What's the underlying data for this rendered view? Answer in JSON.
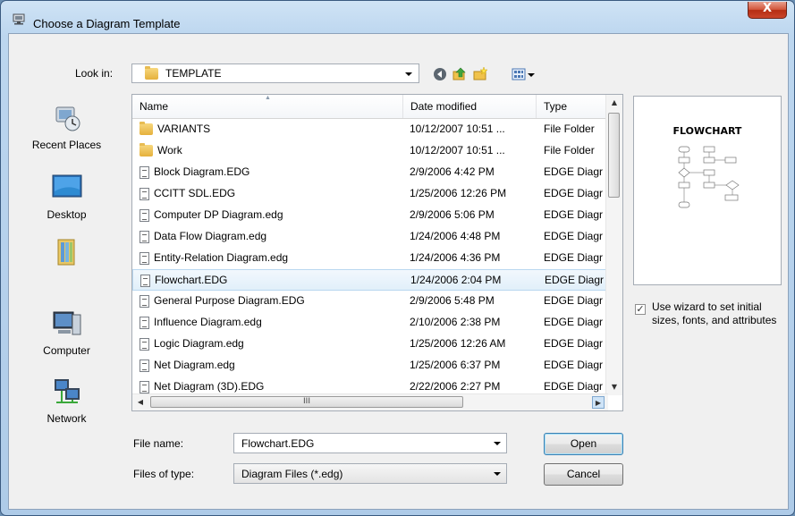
{
  "window": {
    "title": "Choose a Diagram Template",
    "close_label": "X"
  },
  "lookin": {
    "label": "Look in:",
    "value": "TEMPLATE"
  },
  "toolbar_icons": [
    "back-icon",
    "up-folder-icon",
    "new-folder-icon",
    "view-menu-icon"
  ],
  "places": [
    {
      "label": "Recent Places",
      "icon": "recent-places-icon"
    },
    {
      "label": "Desktop",
      "icon": "desktop-icon"
    },
    {
      "label": "",
      "icon": "documents-icon"
    },
    {
      "label": "Computer",
      "icon": "computer-icon"
    },
    {
      "label": "Network",
      "icon": "network-icon"
    }
  ],
  "columns": {
    "name": "Name",
    "date": "Date modified",
    "type": "Type"
  },
  "files": [
    {
      "name": "VARIANTS",
      "date": "10/12/2007 10:51 ...",
      "type": "File Folder",
      "kind": "folder"
    },
    {
      "name": "Work",
      "date": "10/12/2007 10:51 ...",
      "type": "File Folder",
      "kind": "folder"
    },
    {
      "name": "Block Diagram.EDG",
      "date": "2/9/2006 4:42 PM",
      "type": "EDGE Diagr",
      "kind": "file"
    },
    {
      "name": "CCITT SDL.EDG",
      "date": "1/25/2006 12:26 PM",
      "type": "EDGE Diagr",
      "kind": "file"
    },
    {
      "name": "Computer DP Diagram.edg",
      "date": "2/9/2006 5:06 PM",
      "type": "EDGE Diagr",
      "kind": "file"
    },
    {
      "name": "Data Flow Diagram.edg",
      "date": "1/24/2006 4:48 PM",
      "type": "EDGE Diagr",
      "kind": "file"
    },
    {
      "name": "Entity-Relation Diagram.edg",
      "date": "1/24/2006 4:36 PM",
      "type": "EDGE Diagr",
      "kind": "file"
    },
    {
      "name": "Flowchart.EDG",
      "date": "1/24/2006 2:04 PM",
      "type": "EDGE Diagr",
      "kind": "file",
      "selected": true
    },
    {
      "name": "General Purpose Diagram.EDG",
      "date": "2/9/2006 5:48 PM",
      "type": "EDGE Diagr",
      "kind": "file"
    },
    {
      "name": "Influence Diagram.edg",
      "date": "2/10/2006 2:38 PM",
      "type": "EDGE Diagr",
      "kind": "file"
    },
    {
      "name": "Logic Diagram.edg",
      "date": "1/25/2006 12:26 AM",
      "type": "EDGE Diagr",
      "kind": "file"
    },
    {
      "name": "Net Diagram.edg",
      "date": "1/25/2006 6:37 PM",
      "type": "EDGE Diagr",
      "kind": "file"
    },
    {
      "name": "Net Diagram (3D).EDG",
      "date": "2/22/2006 2:27 PM",
      "type": "EDGE Diagr",
      "kind": "file"
    }
  ],
  "hscroll_grip": "III",
  "preview": {
    "title": "FLOWCHART"
  },
  "wizard": {
    "checked": true,
    "check_glyph": "✓",
    "label": "Use wizard to set initial sizes, fonts, and attributes"
  },
  "filename": {
    "label": "File name:",
    "value": "Flowchart.EDG"
  },
  "filetype": {
    "label": "Files of type:",
    "value": "Diagram Files (*.edg)"
  },
  "buttons": {
    "open": "Open",
    "cancel": "Cancel"
  }
}
